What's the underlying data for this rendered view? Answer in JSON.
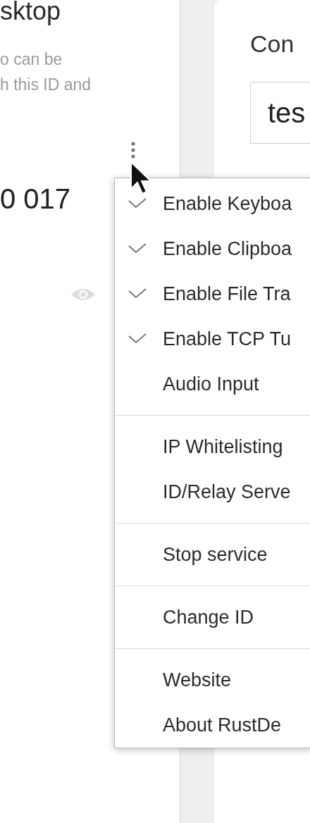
{
  "left_panel": {
    "title": "sktop",
    "description_lines": [
      "o can be",
      "h this ID and"
    ],
    "id_value": "0 017"
  },
  "right_panel": {
    "heading": "Con",
    "id_field": {
      "value": "tes"
    }
  },
  "menu": {
    "groups": [
      {
        "items": [
          {
            "kind": "toggle",
            "label": "Enable Keyboa",
            "checked": true
          },
          {
            "kind": "toggle",
            "label": "Enable Clipboa",
            "checked": true
          },
          {
            "kind": "toggle",
            "label": "Enable File Tra",
            "checked": true
          },
          {
            "kind": "toggle",
            "label": "Enable TCP Tu",
            "checked": true
          },
          {
            "kind": "action",
            "label": "Audio Input"
          }
        ]
      },
      {
        "items": [
          {
            "kind": "action",
            "label": "IP Whitelisting"
          },
          {
            "kind": "action",
            "label": "ID/Relay Serve"
          }
        ]
      },
      {
        "items": [
          {
            "kind": "action",
            "label": "Stop service"
          }
        ]
      },
      {
        "items": [
          {
            "kind": "action",
            "label": "Change ID"
          }
        ]
      },
      {
        "items": [
          {
            "kind": "action",
            "label": "Website"
          },
          {
            "kind": "action",
            "label": "About RustDe"
          }
        ]
      }
    ]
  }
}
